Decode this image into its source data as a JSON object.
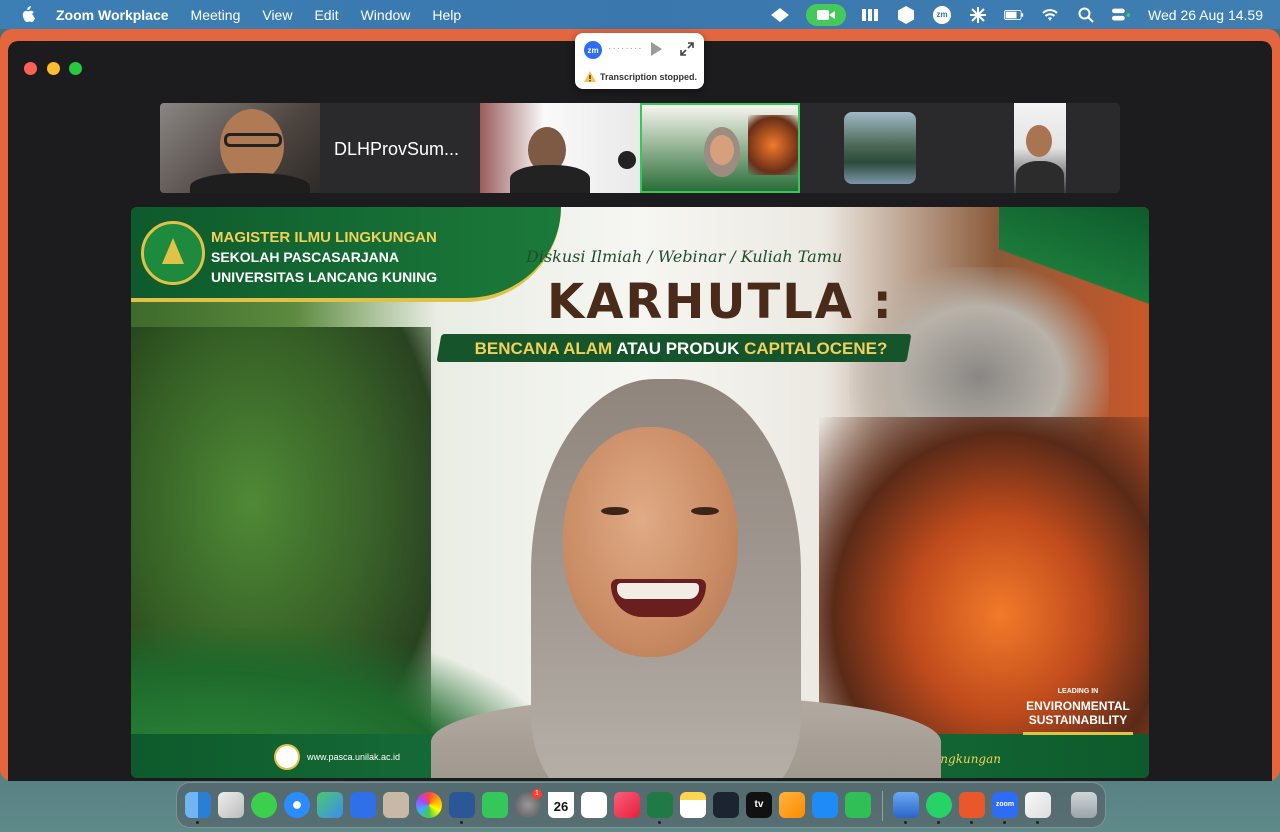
{
  "menubar": {
    "items": [
      "Zoom Workplace",
      "Meeting",
      "View",
      "Edit",
      "Window",
      "Help"
    ],
    "clock": "Wed 26 Aug  14.59",
    "zm_badge": "zm"
  },
  "popup": {
    "zm": "zm",
    "dots": "········",
    "message": "Transcription stopped."
  },
  "gallery": {
    "participant_name": "DLHProvSum..."
  },
  "presentation": {
    "institution_line1": "MAGISTER ILMU LINGKUNGAN",
    "institution_line2": "SEKOLAH PASCASARJANA",
    "institution_line3": "UNIVERSITAS LANCANG KUNING",
    "subtitle": "Diskusi Ilmiah / Webinar / Kuliah Tamu",
    "title": "KARHUTLA :",
    "tagline_part1": "BENCANA ALAM",
    "tagline_part2": " ATAU PRODUK ",
    "tagline_part3": "CAPITALOCENE?",
    "website": "www.pasca.unilak.ac.id",
    "lingkungan": "Lingkungan",
    "leading_small": "LEADING IN",
    "leading_big": "ENVIRONMENTAL SUSTAINABILITY"
  },
  "dock": {
    "calendar_day": "26",
    "settings_badge": "1",
    "tv_label": "tv",
    "zoom_label": "zoom"
  },
  "colors": {
    "menubar": "#3a77ad",
    "window_frame": "#e4663f",
    "accent_green": "#35c759",
    "brand_green": "#0e5a2c",
    "gold": "#e0c247"
  }
}
